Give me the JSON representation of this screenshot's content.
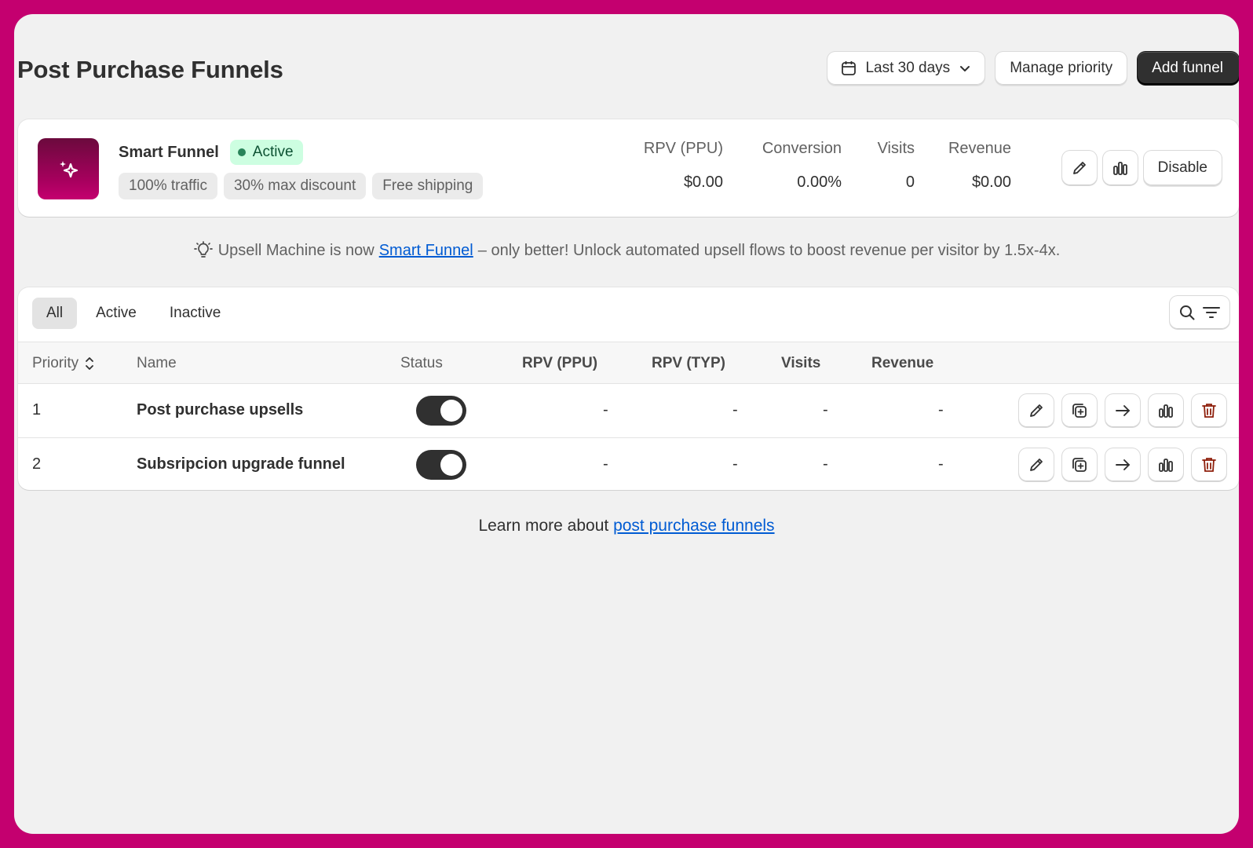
{
  "header": {
    "title": "Post Purchase Funnels",
    "date_range": "Last 30 days",
    "manage_priority": "Manage priority",
    "add_funnel": "Add funnel"
  },
  "smart_funnel": {
    "name": "Smart Funnel",
    "status": "Active",
    "chips": [
      "100% traffic",
      "30% max discount",
      "Free shipping"
    ],
    "metrics": [
      {
        "label": "RPV (PPU)",
        "value": "$0.00"
      },
      {
        "label": "Conversion",
        "value": "0.00%"
      },
      {
        "label": "Visits",
        "value": "0"
      },
      {
        "label": "Revenue",
        "value": "$0.00"
      }
    ],
    "disable_label": "Disable"
  },
  "notice": {
    "prefix": "Upsell Machine is now",
    "link": "Smart Funnel",
    "suffix": "– only better! Unlock automated upsell flows to boost revenue per visitor by 1.5x-4x."
  },
  "tabs": [
    "All",
    "Active",
    "Inactive"
  ],
  "table": {
    "columns": {
      "priority": "Priority",
      "name": "Name",
      "status": "Status",
      "rpv_ppu": "RPV (PPU)",
      "rpv_typ": "RPV (TYP)",
      "visits": "Visits",
      "revenue": "Revenue"
    },
    "rows": [
      {
        "priority": "1",
        "name": "Post purchase upsells",
        "active": true,
        "rpv_ppu": "-",
        "rpv_typ": "-",
        "visits": "-",
        "revenue": "-"
      },
      {
        "priority": "2",
        "name": "Subsripcion upgrade funnel",
        "active": true,
        "rpv_ppu": "-",
        "rpv_typ": "-",
        "visits": "-",
        "revenue": "-"
      }
    ]
  },
  "footer": {
    "prefix": "Learn more about",
    "link": "post purchase funnels"
  },
  "colors": {
    "frame": "#c4006f",
    "primary_button": "#303030",
    "active_badge_bg": "#cdfee1",
    "link": "#005bd3",
    "delete_icon": "#8e1f0b"
  }
}
